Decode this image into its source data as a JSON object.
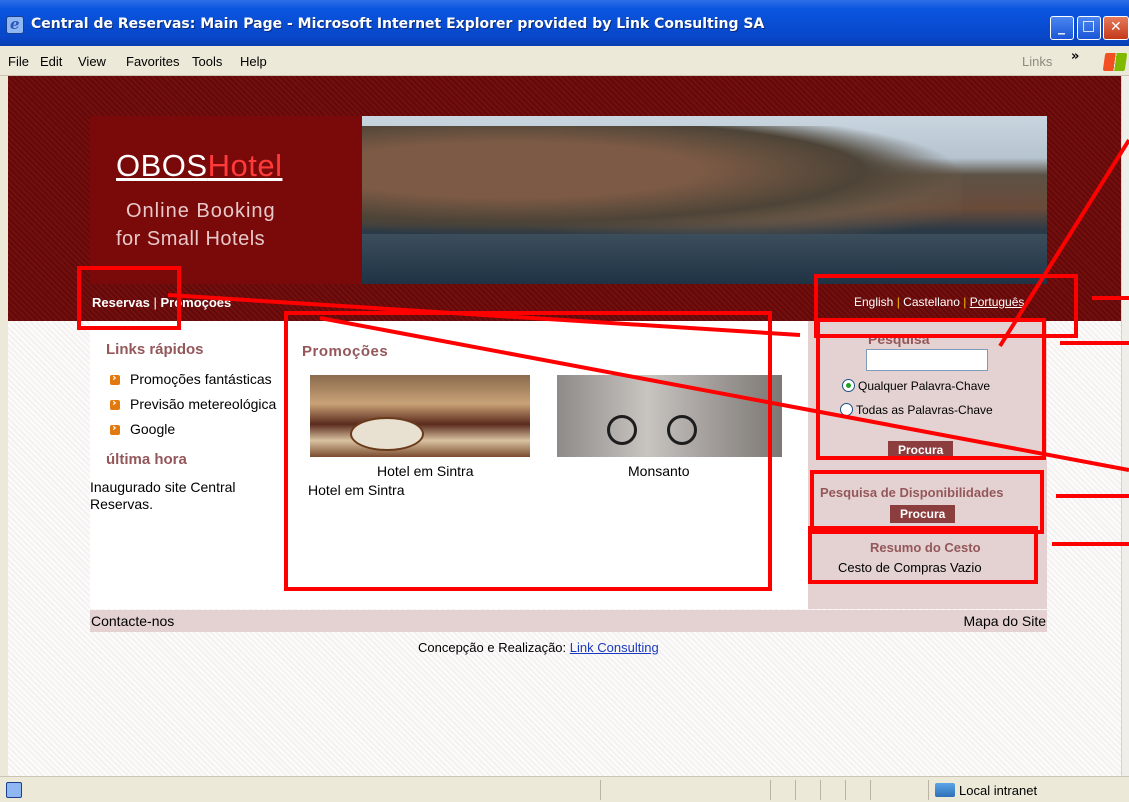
{
  "window": {
    "title": "Central de Reservas: Main Page - Microsoft Internet Explorer provided by Link Consulting SA",
    "minimize": "_",
    "maximize": "□",
    "close": "✕"
  },
  "menubar": {
    "items": [
      "File",
      "Edit",
      "View",
      "Favorites",
      "Tools",
      "Help"
    ],
    "links_label": "Links",
    "links_chevron": "»"
  },
  "site": {
    "logo": {
      "primary": "OBOS",
      "accent": "Hotel",
      "tagline_1": "Online  Booking",
      "tagline_2": "for Small Hotels"
    },
    "nav": {
      "item_1": "Reservas",
      "separator": "|",
      "item_2": "Promoções"
    },
    "languages": {
      "english": "English",
      "castellano": "Castellano",
      "portugues": "Português",
      "separator": "|"
    },
    "quick_links": {
      "title": "Links rápidos",
      "items": [
        "Promoções fantásticas",
        "Previsão metereológica",
        "Google"
      ]
    },
    "news": {
      "title": "última hora",
      "text": "Inaugurado site Central Reservas."
    },
    "promotions": {
      "title": "Promoções",
      "caption_1": "Hotel em Sintra",
      "caption_2": "Monsanto",
      "caption_3": "Hotel em Sintra"
    },
    "search": {
      "title": "Pesquisa",
      "input_value": "",
      "radio_1": "Qualquer Palavra-Chave",
      "radio_2": "Todas as Palavras-Chave",
      "button": "Procura"
    },
    "availability": {
      "title": "Pesquisa de Disponibilidades",
      "button": "Procura"
    },
    "basket": {
      "title": "Resumo do Cesto",
      "text": "Cesto de Compras Vazio"
    },
    "footer": {
      "contact": "Contacte-nos",
      "sitemap": "Mapa do Site",
      "credits_label": "Concepção e Realização:",
      "credits_link": "Link Consulting"
    }
  },
  "statusbar": {
    "zone": "Local intranet"
  },
  "colors": {
    "accent": "#94575a",
    "banner": "#6b0b0b",
    "annotation": "#ff0000",
    "button": "#8c3d3d"
  }
}
